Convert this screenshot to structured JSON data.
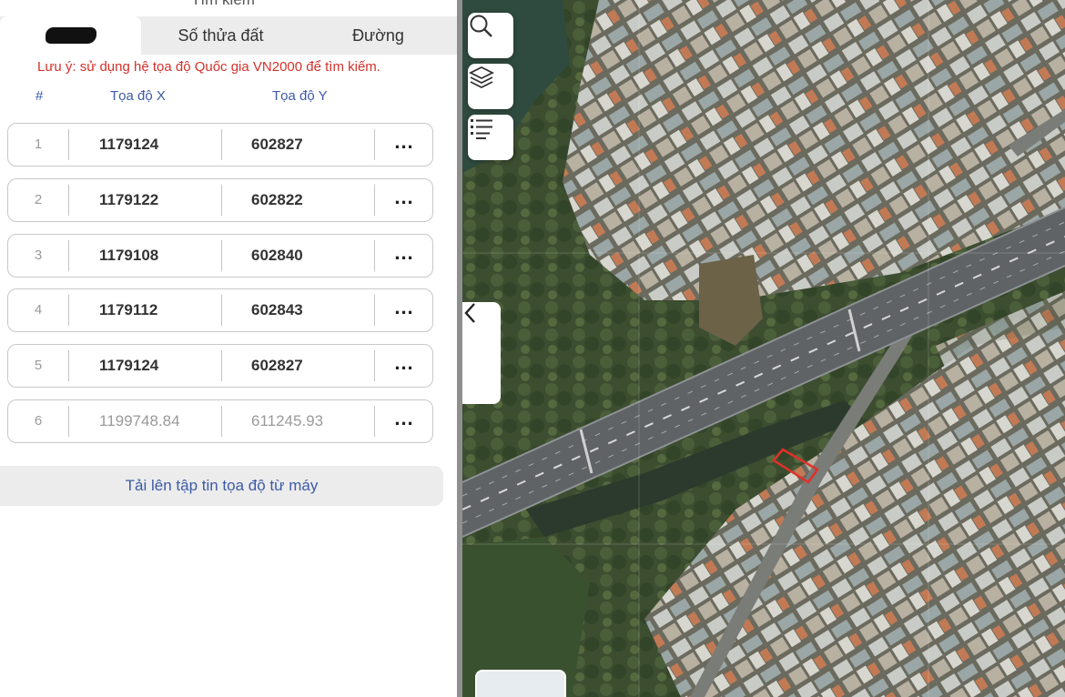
{
  "panel": {
    "title": "Tìm kiếm",
    "tabs": [
      {
        "label": ""
      },
      {
        "label": "Số thửa đất"
      },
      {
        "label": "Đường"
      }
    ],
    "note": "Lưu ý: sử dụng hệ tọa độ Quốc gia VN2000 để tìm kiếm.",
    "columns": {
      "index": "#",
      "x": "Tọa độ X",
      "y": "Tọa độ Y"
    },
    "rows": [
      {
        "index": "1",
        "x": "1179124",
        "y": "602827",
        "more": "..."
      },
      {
        "index": "2",
        "x": "1179122",
        "y": "602822",
        "more": "..."
      },
      {
        "index": "3",
        "x": "1179108",
        "y": "602840",
        "more": "..."
      },
      {
        "index": "4",
        "x": "1179112",
        "y": "602843",
        "more": "..."
      },
      {
        "index": "5",
        "x": "1179124",
        "y": "602827",
        "more": "..."
      },
      {
        "index": "6",
        "x": "1199748.84",
        "y": "611245.93",
        "more": "..."
      }
    ],
    "upload_label": "Tải lên tập tin tọa độ từ máy"
  },
  "map": {
    "buttons": [
      {
        "icon": "search-icon"
      },
      {
        "icon": "layers-icon"
      },
      {
        "icon": "list-icon"
      }
    ],
    "collapse_icon": "chevron-left-icon",
    "colors": {
      "highlight": "#e0302a",
      "vegetation": "#3f5233",
      "road": "#5f6366"
    }
  }
}
